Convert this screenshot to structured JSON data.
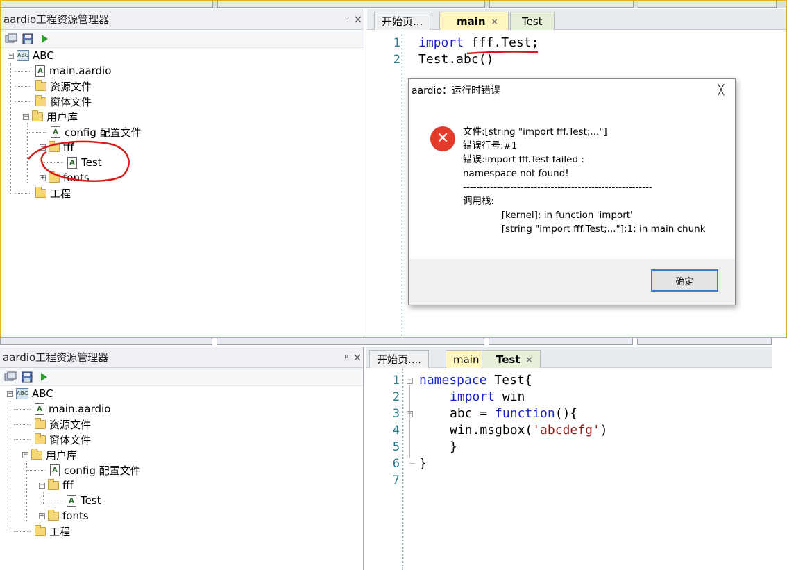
{
  "top": {
    "panel": {
      "title": "aardio工程资源管理器",
      "pin": "ᵖ",
      "close": "×",
      "tree": {
        "root": "ABC",
        "main": "main.aardio",
        "res": "资源文件",
        "forms": "窗体文件",
        "lib": "用户库",
        "config": "config 配置文件",
        "fff": "fff",
        "test": "Test",
        "fonts": "fonts",
        "project": "工程"
      }
    },
    "tabs": {
      "start": "开始页...",
      "main": "main",
      "test": "Test",
      "close": "×"
    },
    "code": {
      "lines": [
        "1",
        "2"
      ],
      "l1_kw": "import",
      "l1_rest": " fff.Test;",
      "l2": "Test.abc()"
    },
    "dialog": {
      "title": "aardio：运行时错误",
      "close": "╳",
      "icon": "✕",
      "message": "文件:[string \"import fff.Test;...\"]\n错误行号:#1\n错误:import fff.Test failed :\nnamespace not found!\n--------------------------------------------------------\n调用栈:\n             [kernel]: in function 'import'\n             [string \"import fff.Test;...\"]:1: in main chunk",
      "ok": "确定"
    }
  },
  "bottom": {
    "panel": {
      "title": "aardio工程资源管理器",
      "pin": "ᵖ",
      "close": "×",
      "tree": {
        "root": "ABC",
        "main": "main.aardio",
        "res": "资源文件",
        "forms": "窗体文件",
        "lib": "用户库",
        "config": "config 配置文件",
        "fff": "fff",
        "test": "Test",
        "fonts": "fonts",
        "project": "工程"
      }
    },
    "tabs": {
      "start": "开始页....",
      "main": "main",
      "test": "Test",
      "close": "×"
    },
    "code": {
      "lines": [
        "1",
        "2",
        "3",
        "4",
        "5",
        "6",
        "7"
      ],
      "l1_kw": "namespace",
      "l1_rest": " Test{",
      "l2_kw": "import",
      "l2_rest": " win",
      "l3_a": "abc = ",
      "l3_kw": "function",
      "l3_rest": "(){",
      "l4_a": "win.msgbox(",
      "l4_str": "'abcdefg'",
      "l4_b": ")",
      "l5": "}",
      "l6": "}"
    }
  },
  "colors": {
    "accent_border": "#f0a830",
    "keyword": "#1a22cc",
    "string": "#8a1a1a",
    "error": "#e23b2a",
    "annotation": "#d81a1a"
  }
}
